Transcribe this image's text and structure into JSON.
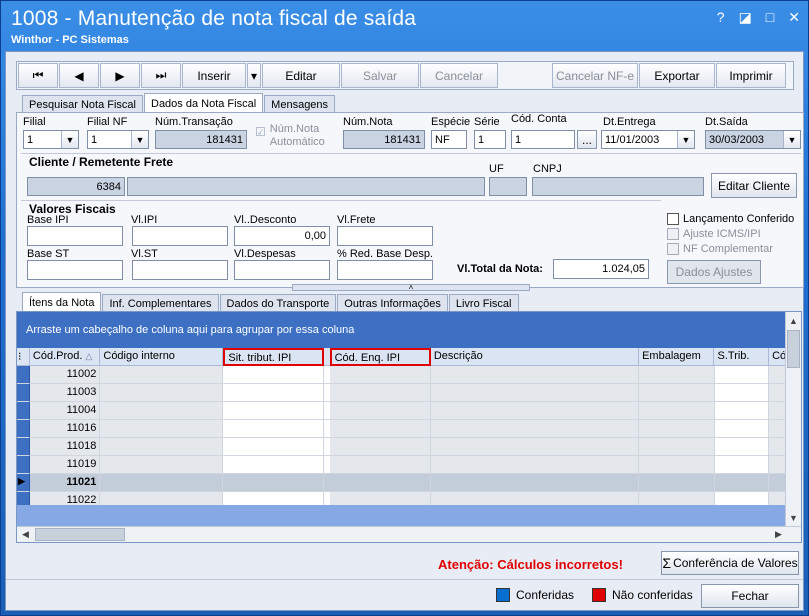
{
  "window": {
    "title": "1008 - Manutenção de nota fiscal de saída",
    "subtitle": "Winthor - PC Sistemas",
    "help": "?",
    "restore": "◪",
    "maximize": "□",
    "close": "✕"
  },
  "toolbar": {
    "first": "⏮",
    "prev": "◀",
    "next": "▶",
    "last": "⏭",
    "inserir": "Inserir",
    "inserir_dropdown": "▾",
    "editar": "Editar",
    "salvar": "Salvar",
    "cancelar": "Cancelar",
    "cancelar_nfe": "Cancelar NF-e",
    "exportar": "Exportar",
    "imprimir": "Imprimir"
  },
  "top_tabs": [
    "Pesquisar Nota Fiscal",
    "Dados da Nota Fiscal",
    "Mensagens"
  ],
  "form": {
    "filial_label": "Filial",
    "filial_value": "1",
    "filial_nf_label": "Filial NF",
    "filial_nf_value": "1",
    "num_transacao_label": "Núm.Transação",
    "num_transacao_value": "181431",
    "num_nota_auto_label": "Núm.Nota Automático",
    "num_nota_label": "Núm.Nota",
    "num_nota_value": "181431",
    "especie_label": "Espécie",
    "especie_value": "NF",
    "serie_label": "Série",
    "serie_value": "1",
    "cod_conta_label": "Cód. Conta",
    "cod_conta_value": "1",
    "cod_conta_btn": "...",
    "dt_entrega_label": "Dt.Entrega",
    "dt_entrega_value": "11/01/2003",
    "dt_saida_label": "Dt.Saída",
    "dt_saida_value": "30/03/2003",
    "cliente_title": "Cliente / Remetente Frete",
    "uf_label": "UF",
    "cnpj_label": "CNPJ",
    "cliente_code": "6384",
    "editar_cliente": "Editar Cliente",
    "valores_title": "Valores Fiscais",
    "base_ipi_label": "Base IPI",
    "vl_ipi_label": "Vl.IPI",
    "vl_desconto_label": "Vl..Desconto",
    "vl_desconto_value": "0,00",
    "vl_frete_label": "Vl.Frete",
    "base_st_label": "Base ST",
    "vl_st_label": "Vl.ST",
    "vl_despesas_label": "Vl.Despesas",
    "red_base_label": "% Red. Base Desp.",
    "total_label": "Vl.Total da Nota:",
    "total_value": "1.024,05",
    "lancamento_label": "Lançamento Conferido",
    "ajuste_label": "Ajuste ICMS/IPI",
    "nf_comp_label": "NF Complementar",
    "dados_ajustes": "Dados Ajustes",
    "splitter": "˄"
  },
  "sub_tabs": [
    "Ítens da Nota",
    "Inf. Complementares",
    "Dados do Transporte",
    "Outras Informações",
    "Livro Fiscal"
  ],
  "grid": {
    "group_hint": "Arraste um cabeçalho de coluna aqui para agrupar por essa coluna",
    "row_indicator_icon": "⁝",
    "columns": [
      "Cód.Prod.",
      "Código interno",
      "Sit. tribut. IPI",
      "Cód. Enq. IPI",
      "Descrição",
      "Embalagem",
      "S.Trib.",
      "Cód"
    ],
    "sort_icon": "△",
    "rows": [
      "11002",
      "11003",
      "11004",
      "11016",
      "11018",
      "11019",
      "11021",
      "11022"
    ],
    "selected_marker": "▶",
    "scroll_up": "▲",
    "scroll_down": "▼",
    "scroll_left": "◀",
    "scroll_right": "▶"
  },
  "warning": "Atenção: Cálculos incorretos!",
  "conferencia_btn": "Conferência de Valores",
  "conferencia_icon": "Σ",
  "legend": {
    "conferidas": "Conferidas",
    "nao_conferidas": "Não conferidas",
    "blue": "#0a6ed1",
    "red": "#e00000"
  },
  "fechar": "Fechar"
}
